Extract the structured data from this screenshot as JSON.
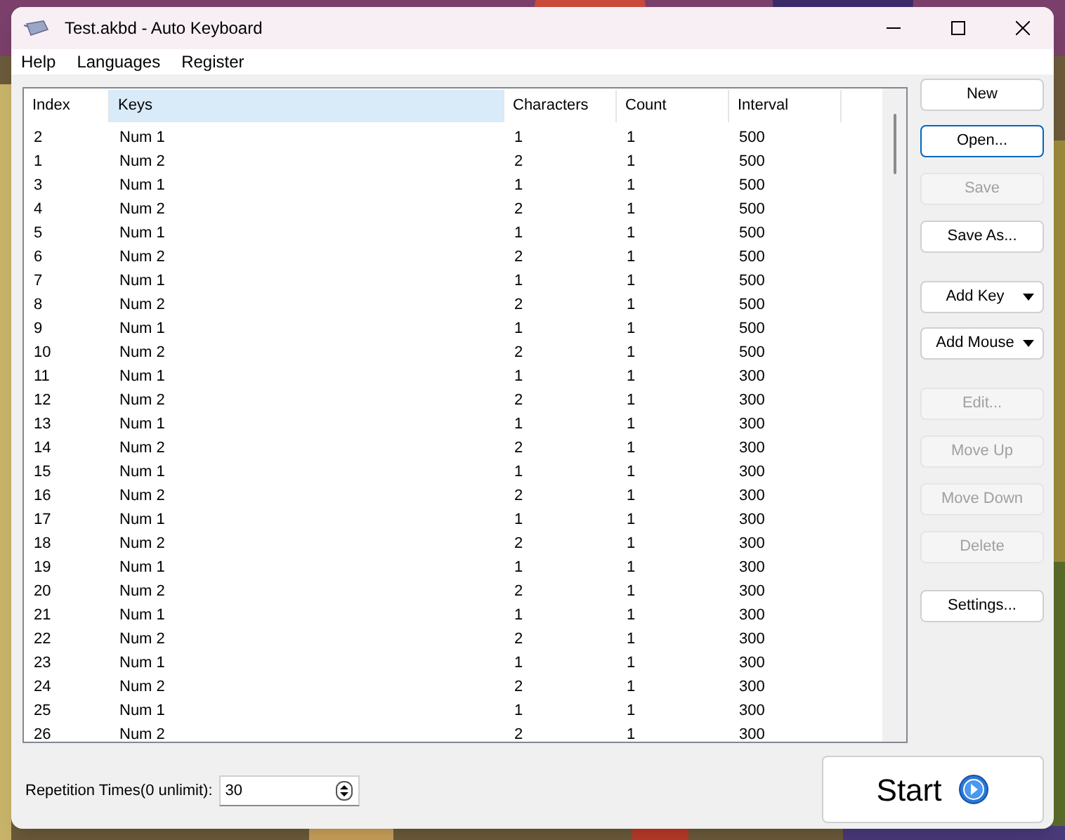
{
  "window": {
    "title": "Test.akbd - Auto Keyboard"
  },
  "menu": [
    "Help",
    "Languages",
    "Register"
  ],
  "table": {
    "columns": [
      {
        "label": "Index",
        "selected": false
      },
      {
        "label": "Keys",
        "selected": true
      },
      {
        "label": "Characters",
        "selected": false
      },
      {
        "label": "Count",
        "selected": false
      },
      {
        "label": "Interval",
        "selected": false
      }
    ],
    "rows": [
      [
        "2",
        "Num 1",
        "1",
        "1",
        "500"
      ],
      [
        "1",
        "Num 2",
        "2",
        "1",
        "500"
      ],
      [
        "3",
        "Num 1",
        "1",
        "1",
        "500"
      ],
      [
        "4",
        "Num 2",
        "2",
        "1",
        "500"
      ],
      [
        "5",
        "Num 1",
        "1",
        "1",
        "500"
      ],
      [
        "6",
        "Num 2",
        "2",
        "1",
        "500"
      ],
      [
        "7",
        "Num 1",
        "1",
        "1",
        "500"
      ],
      [
        "8",
        "Num 2",
        "2",
        "1",
        "500"
      ],
      [
        "9",
        "Num 1",
        "1",
        "1",
        "500"
      ],
      [
        "10",
        "Num 2",
        "2",
        "1",
        "500"
      ],
      [
        "11",
        "Num 1",
        "1",
        "1",
        "300"
      ],
      [
        "12",
        "Num 2",
        "2",
        "1",
        "300"
      ],
      [
        "13",
        "Num 1",
        "1",
        "1",
        "300"
      ],
      [
        "14",
        "Num 2",
        "2",
        "1",
        "300"
      ],
      [
        "15",
        "Num 1",
        "1",
        "1",
        "300"
      ],
      [
        "16",
        "Num 2",
        "2",
        "1",
        "300"
      ],
      [
        "17",
        "Num 1",
        "1",
        "1",
        "300"
      ],
      [
        "18",
        "Num 2",
        "2",
        "1",
        "300"
      ],
      [
        "19",
        "Num 1",
        "1",
        "1",
        "300"
      ],
      [
        "20",
        "Num 2",
        "2",
        "1",
        "300"
      ],
      [
        "21",
        "Num 1",
        "1",
        "1",
        "300"
      ],
      [
        "22",
        "Num 2",
        "2",
        "1",
        "300"
      ],
      [
        "23",
        "Num 1",
        "1",
        "1",
        "300"
      ],
      [
        "24",
        "Num 2",
        "2",
        "1",
        "300"
      ],
      [
        "25",
        "Num 1",
        "1",
        "1",
        "300"
      ],
      [
        "26",
        "Num 2",
        "2",
        "1",
        "300"
      ]
    ]
  },
  "buttons": [
    {
      "label": "New",
      "kind": "plain",
      "disabled": false,
      "focused": false
    },
    {
      "label": "Open...",
      "kind": "plain",
      "disabled": false,
      "focused": true
    },
    {
      "label": "Save",
      "kind": "plain",
      "disabled": true,
      "focused": false
    },
    {
      "label": "Save As...",
      "kind": "plain",
      "disabled": false,
      "focused": false
    },
    {
      "label": "Add Key",
      "kind": "dropdown",
      "disabled": false,
      "focused": false
    },
    {
      "label": "Add Mouse",
      "kind": "dropdown",
      "disabled": false,
      "focused": false
    },
    {
      "label": "Edit...",
      "kind": "plain",
      "disabled": true,
      "focused": false
    },
    {
      "label": "Move Up",
      "kind": "plain",
      "disabled": true,
      "focused": false
    },
    {
      "label": "Move Down",
      "kind": "plain",
      "disabled": true,
      "focused": false
    },
    {
      "label": "Delete",
      "kind": "plain",
      "disabled": true,
      "focused": false
    },
    {
      "label": "Settings...",
      "kind": "plain",
      "disabled": false,
      "focused": false
    }
  ],
  "repetition": {
    "label": "Repetition Times(0 unlimit):",
    "value": "30"
  },
  "start_button": {
    "label": "Start"
  }
}
